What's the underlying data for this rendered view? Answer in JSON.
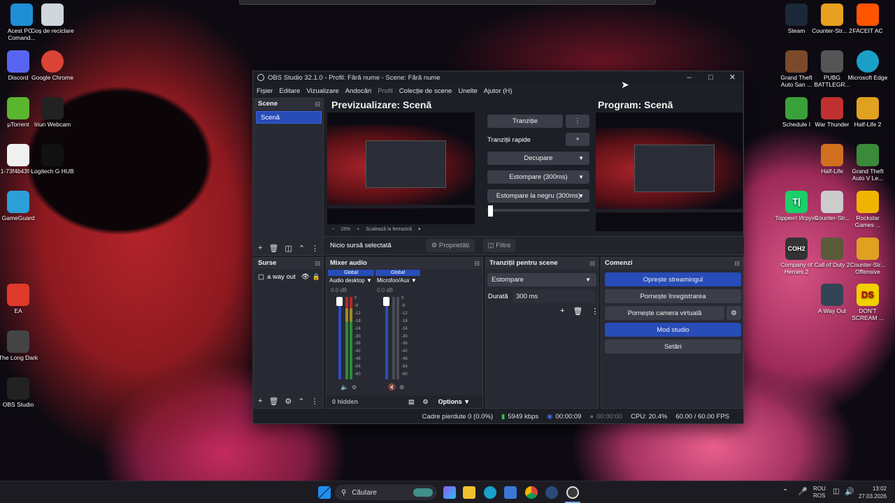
{
  "desktop": {
    "left_icons": [
      {
        "label": "Acest PC - Comand...",
        "icon": "monitor-icon",
        "color": "#1e8fd6"
      },
      {
        "label": "Coș de reciclare",
        "icon": "recycle-bin-icon",
        "color": "#cfd6dc"
      },
      {
        "label": "Discord",
        "icon": "discord-icon",
        "color": "#5865f2"
      },
      {
        "label": "Google Chrome",
        "icon": "chrome-icon",
        "color": "#db4437"
      },
      {
        "label": "µTorrent",
        "icon": "utorrent-icon",
        "color": "#5ab52f"
      },
      {
        "label": "Iriun Webcam",
        "icon": "webcam-icon",
        "color": "#222222"
      },
      {
        "label": "1-73f4b43f-...",
        "icon": "file-icon",
        "color": "#f0f0f0"
      },
      {
        "label": "Logitech G HUB",
        "icon": "logitech-icon",
        "color": "#111111"
      },
      {
        "label": "GameGuard",
        "icon": "gameguard-icon",
        "color": "#2a9fd8"
      },
      {
        "label": "EA",
        "icon": "ea-icon",
        "color": "#e03a2a"
      },
      {
        "label": "The Long Dark",
        "icon": "axe-icon",
        "color": "#444444"
      },
      {
        "label": "OBS Studio",
        "icon": "obs-icon",
        "color": "#222222"
      }
    ],
    "right_icons": [
      {
        "label": "Steam",
        "icon": "steam-icon",
        "color": "#1b2838"
      },
      {
        "label": "Counter-Str... 2",
        "icon": "cs2-icon",
        "color": "#e8a020"
      },
      {
        "label": "FACEIT AC",
        "icon": "faceit-icon",
        "color": "#ff5500"
      },
      {
        "label": "Grand Theft Auto San ...",
        "icon": "gta-sa-icon",
        "color": "#7a4a2a"
      },
      {
        "label": "PUBG BATTLEGR...",
        "icon": "pubg-icon",
        "color": "#555555"
      },
      {
        "label": "Microsoft Edge",
        "icon": "edge-icon",
        "color": "#1aa0c8"
      },
      {
        "label": "Schedule I",
        "icon": "schedule-icon",
        "color": "#3aa03a"
      },
      {
        "label": "War Thunder",
        "icon": "war-thunder-icon",
        "color": "#c03030"
      },
      {
        "label": "Half-Life 2",
        "icon": "half-life-2-icon",
        "color": "#e0a020"
      },
      {
        "label": "Half-Life",
        "icon": "half-life-icon",
        "color": "#d07020"
      },
      {
        "label": "Grand Theft Auto V Le...",
        "icon": "gta-v-icon",
        "color": "#3a8a3a"
      },
      {
        "label": "Торрент Игруха",
        "icon": "torrent-igruha-icon",
        "color": "#1ad06a"
      },
      {
        "label": "Counter-Str...",
        "icon": "cs-icon",
        "color": "#cccccc"
      },
      {
        "label": "Rockstar Games ...",
        "icon": "rockstar-icon",
        "color": "#f0b400"
      },
      {
        "label": "Company of Heroes 2",
        "icon": "coh2-icon",
        "color": "#333333"
      },
      {
        "label": "Call of Duty 2",
        "icon": "cod2-icon",
        "color": "#5a5a3a"
      },
      {
        "label": "Counter-Str... Offensive",
        "icon": "csgo-icon",
        "color": "#e0a020"
      },
      {
        "label": "A Way Out",
        "icon": "a-way-out-icon",
        "color": "#334455"
      },
      {
        "label": "DON'T SCREAM ...",
        "icon": "dont-scream-icon",
        "color": "#f0d000"
      }
    ],
    "ds_text": "DS",
    "coh_text": "COH2",
    "t_text": "T|"
  },
  "obs": {
    "title": "OBS Studio 32.1.0 - Profil: Fără nume - Scene: Fără nume",
    "menu": [
      "Fișier",
      "Editare",
      "Vizualizare",
      "Andocări",
      "Profil",
      "Colecție de scene",
      "Unelte",
      "Ajutor (H)"
    ],
    "preview_heading": "Previzualizare: Scenă",
    "program_heading": "Program: Scenă",
    "zoom": "15%",
    "scale_mode": "Scalează la fereastră",
    "transition": {
      "btn": "Tranziție",
      "quick": "Tranziții rapide",
      "items": [
        "Decupare",
        "Estompare (300ms)",
        "Estompare la negru (300ms)"
      ]
    },
    "scenes": {
      "title": "Scene",
      "items": [
        "Scenă"
      ]
    },
    "no_source": "Nicio sursă selectată",
    "properties": "Proprietăți",
    "filters": "Filtre",
    "sources": {
      "title": "Surse",
      "items": [
        "a way out"
      ]
    },
    "mixer": {
      "title": "Mixer audio",
      "channels": [
        {
          "global": "Global",
          "name": "Audio desktop",
          "db": "0.0 dB"
        },
        {
          "global": "Global",
          "name": "Microfon/Aux",
          "db": "0.0 dB"
        }
      ],
      "scale": [
        "0",
        "-6",
        "-12",
        "-18",
        "-24",
        "-30",
        "-36",
        "-42",
        "-48",
        "-54",
        "-60"
      ],
      "hidden": "0 hidden",
      "options": "Options"
    },
    "scene_transitions": {
      "title": "Tranziții pentru scene",
      "selected": "Estompare",
      "duration_label": "Durată",
      "duration": "300 ms"
    },
    "controls": {
      "title": "Comenzi",
      "stream": "Oprește streamingul",
      "record": "Pornește înregistrarea",
      "vcam": "Pornește camera virtuală",
      "studio": "Mod studio",
      "settings": "Setări"
    },
    "status": {
      "dropped": "Cadre pierdute 0 (0.0%)",
      "bitrate": "5949 kbps",
      "stream_time": "00:00:09",
      "rec_time": "00:00:00",
      "cpu": "CPU: 20.4%",
      "fps": "60.00 / 60.00 FPS"
    }
  },
  "taskbar": {
    "search": "Căutare",
    "lang1": "ROU",
    "lang2": "ROS",
    "time": "13:02",
    "date": "27.03.2026"
  }
}
